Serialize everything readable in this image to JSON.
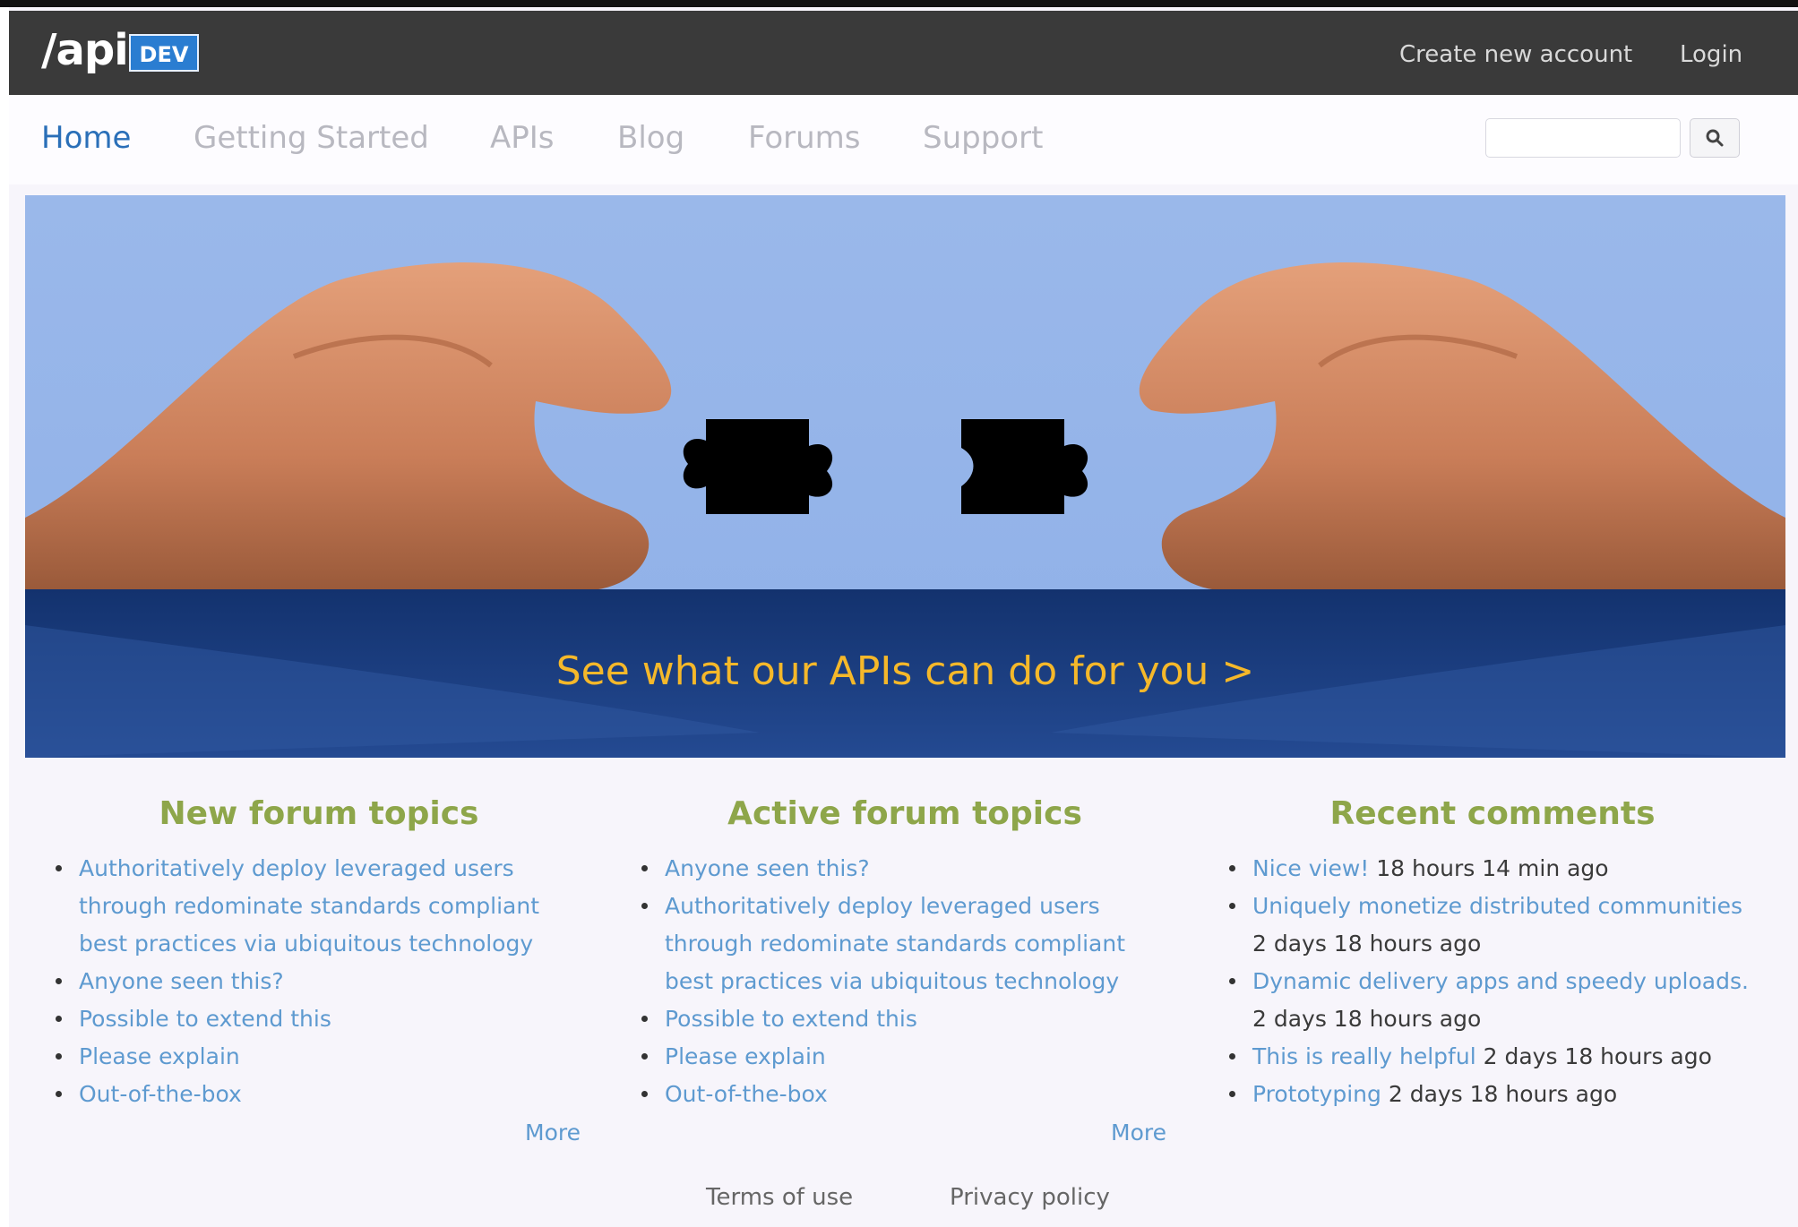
{
  "header": {
    "logo_text": "/api",
    "logo_badge": "DEV",
    "create_account": "Create new account",
    "login": "Login"
  },
  "nav": {
    "items": [
      "Home",
      "Getting Started",
      "APIs",
      "Blog",
      "Forums",
      "Support"
    ],
    "active": "Home",
    "search_value": ""
  },
  "hero": {
    "cta": "See what our APIs can do for you >"
  },
  "columns": {
    "new_topics": {
      "title": "New forum topics",
      "items": [
        "Authoritatively deploy leveraged users through redominate standards compliant best practices via ubiquitous technology",
        "Anyone seen this?",
        "Possible to extend this",
        "Please explain",
        "Out-of-the-box"
      ],
      "more": "More"
    },
    "active_topics": {
      "title": "Active forum topics",
      "items": [
        "Anyone seen this?",
        "Authoritatively deploy leveraged users through redominate standards compliant best practices via ubiquitous technology",
        "Possible to extend this",
        "Please explain",
        "Out-of-the-box"
      ],
      "more": "More"
    },
    "recent_comments": {
      "title": "Recent comments",
      "items": [
        {
          "link": "Nice view!",
          "time": "18 hours 14 min ago"
        },
        {
          "link": "Uniquely monetize distributed communities",
          "time": "2 days 18 hours ago"
        },
        {
          "link": "Dynamic delivery apps and speedy uploads.",
          "time": "2 days 18 hours ago"
        },
        {
          "link": "This is really helpful",
          "time": "2 days 18 hours ago"
        },
        {
          "link": "Prototyping",
          "time": "2 days 18 hours ago"
        }
      ]
    }
  },
  "footer": {
    "terms": "Terms of use",
    "privacy": "Privacy policy"
  }
}
